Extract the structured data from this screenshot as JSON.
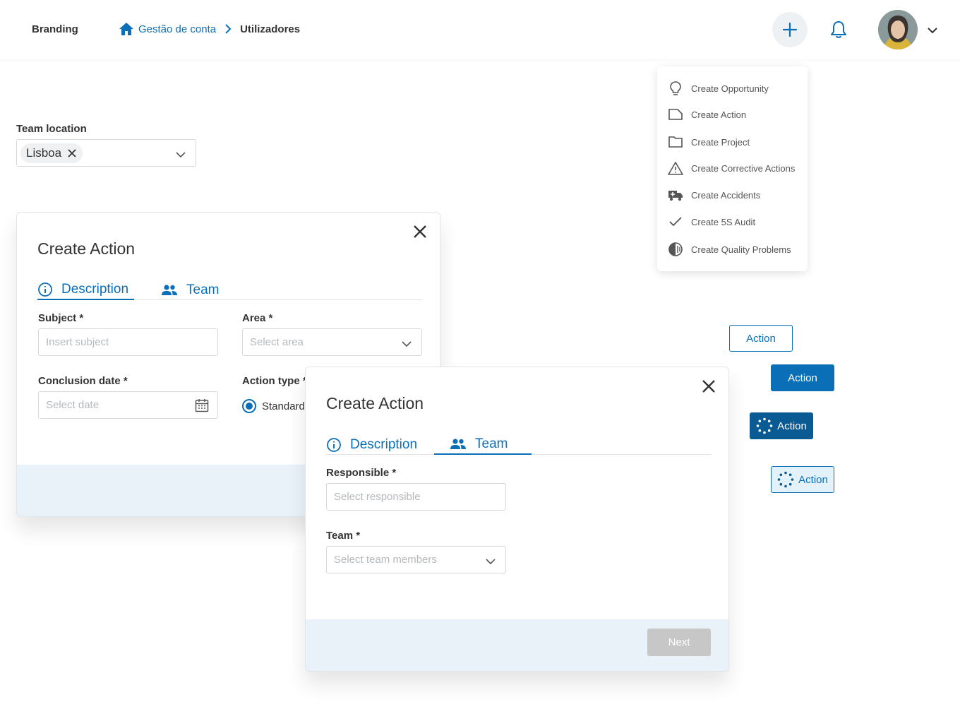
{
  "header": {
    "brand": "Branding",
    "breadcrumb_home": "Gestão de conta",
    "breadcrumb_current": "Utilizadores"
  },
  "create_menu": {
    "items": [
      {
        "label": "Create Opportunity",
        "icon": "lightbulb-icon"
      },
      {
        "label": "Create Action",
        "icon": "document-icon"
      },
      {
        "label": "Create Project",
        "icon": "folder-icon"
      },
      {
        "label": "Create Corrective Actions",
        "icon": "warning-icon"
      },
      {
        "label": "Create Accidents",
        "icon": "ambulance-icon"
      },
      {
        "label": "Create 5S Audit",
        "icon": "check-icon"
      },
      {
        "label": "Create Quality Problems",
        "icon": "half-circle-icon"
      }
    ]
  },
  "team_location": {
    "label": "Team location",
    "selected": "Lisboa"
  },
  "modal_description": {
    "title": "Create Action",
    "tabs": [
      "Description",
      "Team"
    ],
    "active_tab": "Description",
    "subject_label": "Subject *",
    "subject_placeholder": "Insert subject",
    "area_label": "Area *",
    "area_placeholder": "Select area",
    "conclusion_label": "Conclusion date *",
    "conclusion_placeholder": "Select date",
    "action_type_label": "Action type *",
    "action_type_option": "Standard"
  },
  "modal_team": {
    "title": "Create Action",
    "tabs": [
      "Description",
      "Team"
    ],
    "active_tab": "Team",
    "responsible_label": "Responsible *",
    "responsible_placeholder": "Select responsible",
    "team_label": "Team *",
    "team_placeholder": "Select team members",
    "next_label": "Next"
  },
  "action_buttons": {
    "outline": "Action",
    "filled": "Action",
    "loading_dark": "Action",
    "loading_light": "Action"
  },
  "colors": {
    "primary": "#0b6fb8",
    "primary_dark": "#0a5a93",
    "footer_bg": "#e9f2f9",
    "disabled_btn": "#c7c7c7"
  }
}
